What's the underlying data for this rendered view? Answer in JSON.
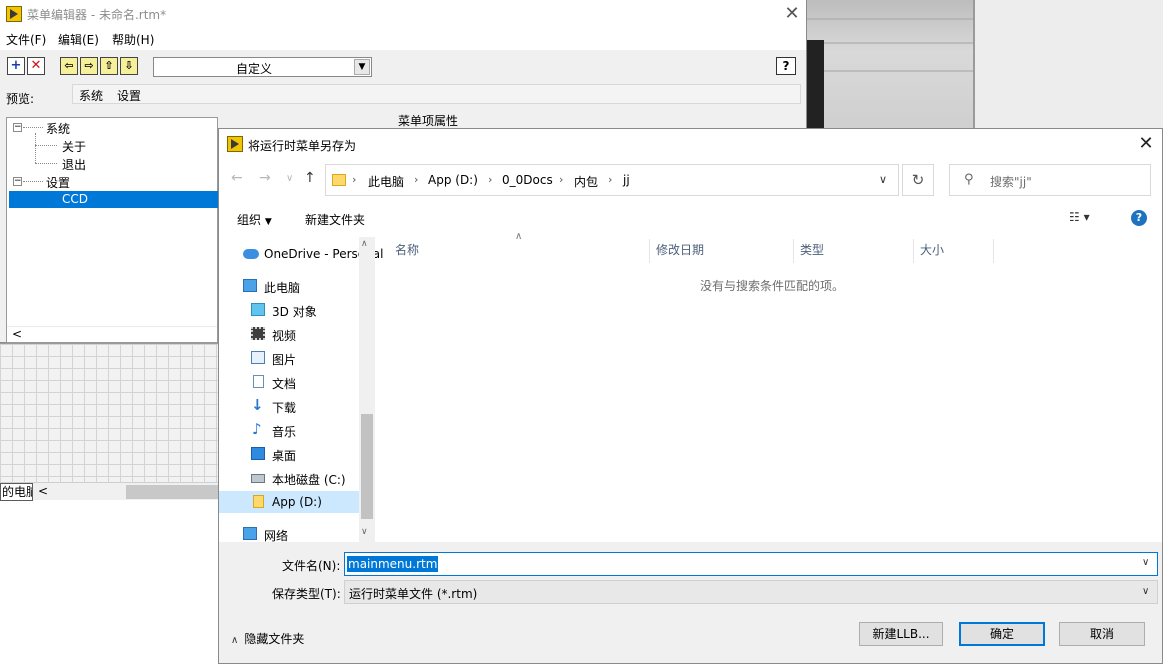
{
  "editor": {
    "title": "菜单编辑器 - 未命名.rtm*",
    "menus": [
      "文件(F)",
      "编辑(E)",
      "帮助(H)"
    ],
    "combo_value": "自定义",
    "help_label": "?",
    "preview_label": "预览:",
    "preview_items": [
      "系统",
      "设置"
    ],
    "tree": [
      {
        "label": "系统",
        "level": 0
      },
      {
        "label": "关于",
        "level": 1
      },
      {
        "label": "退出",
        "level": 1
      },
      {
        "label": "设置",
        "level": 0
      },
      {
        "label": "CCD",
        "level": 1,
        "selected": true
      }
    ],
    "props_label": "菜单项属性"
  },
  "grid": {
    "label": "的电脑"
  },
  "dialog": {
    "title": "将运行时菜单另存为",
    "breadcrumb": [
      "此电脑",
      "App (D:)",
      "0_0Docs",
      "内包",
      "jj"
    ],
    "search_placeholder": "搜索\"jj\"",
    "organize": "组织",
    "new_folder": "新建文件夹",
    "nav_items": [
      {
        "label": "OneDrive - Personal",
        "icon": "cloud-icon"
      },
      {
        "label": "此电脑",
        "icon": "computer-icon"
      },
      {
        "label": "3D 对象",
        "icon": "cube-icon"
      },
      {
        "label": "视频",
        "icon": "film-icon"
      },
      {
        "label": "图片",
        "icon": "picture-icon"
      },
      {
        "label": "文档",
        "icon": "document-icon"
      },
      {
        "label": "下载",
        "icon": "download-icon"
      },
      {
        "label": "音乐",
        "icon": "music-icon"
      },
      {
        "label": "桌面",
        "icon": "desktop-icon"
      },
      {
        "label": "本地磁盘 (C:)",
        "icon": "drive-icon"
      },
      {
        "label": "App (D:)",
        "icon": "folder-icon",
        "selected": true
      },
      {
        "label": "网络",
        "icon": "network-icon"
      }
    ],
    "columns": [
      "名称",
      "修改日期",
      "类型",
      "大小"
    ],
    "empty_message": "没有与搜索条件匹配的项。",
    "filename_label": "文件名(N):",
    "filename_value": "mainmenu.rtm",
    "filetype_label": "保存类型(T):",
    "filetype_value": "运行时菜单文件 (*.rtm)",
    "hide_folders": "隐藏文件夹",
    "btn_new_llb": "新建LLB...",
    "btn_ok": "确定",
    "btn_cancel": "取消"
  },
  "colors": {
    "accent": "#0078d7",
    "selection": "#cce8ff",
    "logo": "#f4c400"
  }
}
